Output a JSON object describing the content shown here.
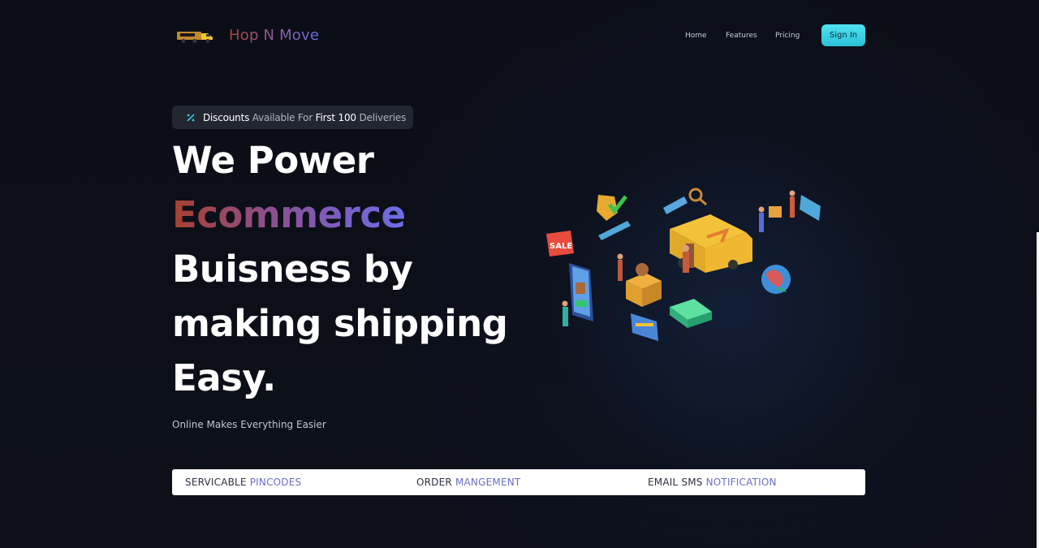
{
  "nav": {
    "brand": "Hop N Move",
    "links": [
      {
        "label": "Home"
      },
      {
        "label": "Features"
      },
      {
        "label": "Pricing"
      }
    ],
    "signin_label": "Sign In"
  },
  "badge": {
    "icon": "percent-icon",
    "parts": [
      "Discounts",
      "Available For",
      "First 100",
      "Deliveries"
    ]
  },
  "hero": {
    "lines": [
      "We Power",
      "Ecommerce",
      "Buisness by",
      "making shipping",
      "Easy."
    ],
    "tagline": "Online Makes Everything Easier"
  },
  "features": [
    {
      "main": "SERVICABLE ",
      "accent": "PINCODES"
    },
    {
      "main": "ORDER ",
      "accent": "MANGEMENT"
    },
    {
      "main": "EMAIL SMS ",
      "accent": "NOTIFICATION"
    }
  ],
  "illustration_text": {
    "sale": "SALE"
  },
  "colors": {
    "background": "#0b0e17",
    "signin": "#3fd6ea",
    "badge_bg": "#222630",
    "accent_purple": "#6a6fc6",
    "gradient_start": "#a8412f",
    "gradient_end": "#6b6fe6"
  }
}
